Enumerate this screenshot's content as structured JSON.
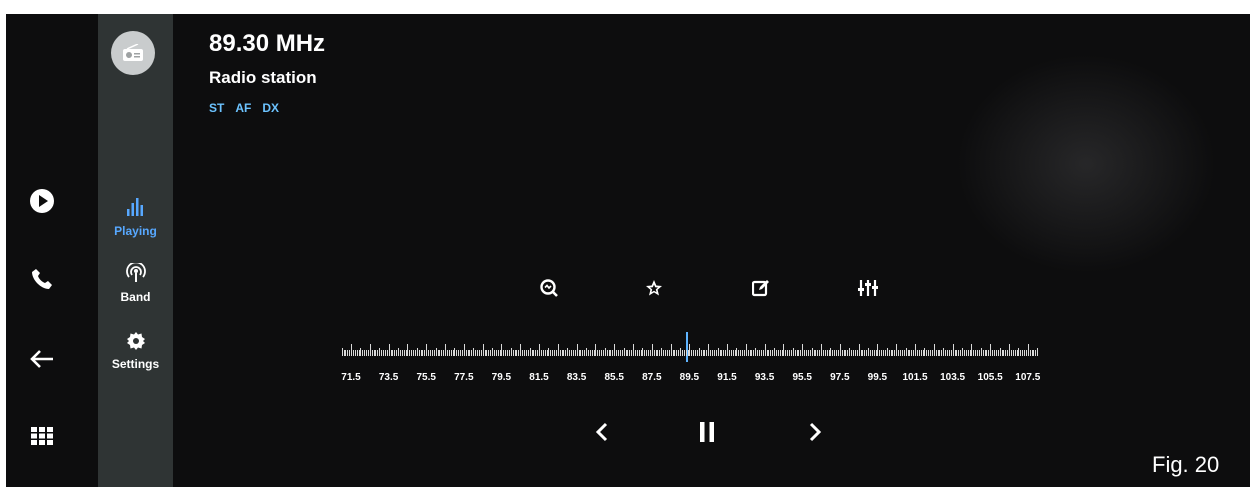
{
  "header": {
    "frequency": "89.30 MHz",
    "station": "Radio station",
    "flags": [
      "ST",
      "AF",
      "DX"
    ]
  },
  "sidebar": {
    "source_icon": "radio-icon",
    "items": [
      {
        "label": "Playing",
        "icon": "equalizer-bars-icon",
        "active": true
      },
      {
        "label": "Band",
        "icon": "antenna-icon",
        "active": false
      },
      {
        "label": "Settings",
        "icon": "gear-icon",
        "active": false
      }
    ]
  },
  "dock": {
    "items": [
      "play-circle-icon",
      "phone-icon",
      "back-arrow-icon",
      "app-grid-icon"
    ]
  },
  "tools": [
    "search-scan-icon",
    "star-icon",
    "edit-icon",
    "sliders-icon"
  ],
  "tuner": {
    "labels": [
      "71.5",
      "73.5",
      "75.5",
      "77.5",
      "79.5",
      "81.5",
      "83.5",
      "85.5",
      "87.5",
      "89.5",
      "91.5",
      "93.5",
      "95.5",
      "97.5",
      "99.5",
      "101.5",
      "103.5",
      "105.5",
      "107.5"
    ],
    "current_mhz": 89.3,
    "min_mhz": 71.5,
    "max_mhz": 107.5
  },
  "transport": [
    "previous-icon",
    "pause-icon",
    "next-icon"
  ],
  "caption": "Fig. 20",
  "colors": {
    "accent": "#57a8ff",
    "flag": "#6cc3ff",
    "sidebar": "#2f3434",
    "screen": "#0d0d0e"
  }
}
